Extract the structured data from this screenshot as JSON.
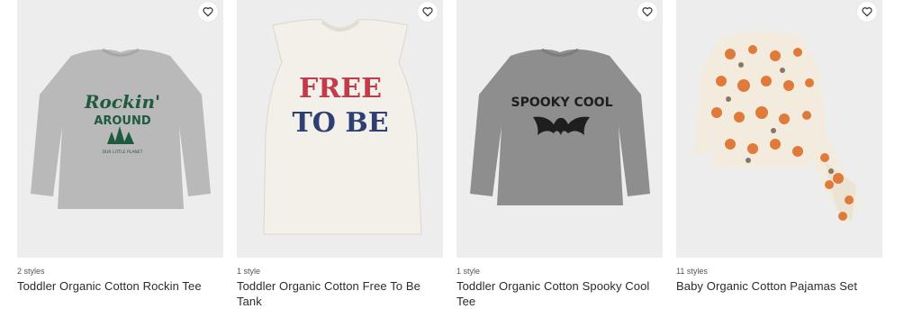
{
  "products": [
    {
      "styles_count": "2 styles",
      "title": "Toddler Organic Cotton Rockin Tee",
      "print_lines": [
        "Rockin'",
        "AROUND",
        "OUR LITTLE PLANET"
      ],
      "image_bg": "#ededed"
    },
    {
      "styles_count": "1 style",
      "title": "Toddler Organic Cotton Free To Be Tank",
      "print_lines": [
        "FREE",
        "TO BE"
      ],
      "image_bg": "#ededed"
    },
    {
      "styles_count": "1 style",
      "title": "Toddler Organic Cotton Spooky Cool Tee",
      "print_lines": [
        "SPOOKY COOL"
      ],
      "image_bg": "#ededed"
    },
    {
      "styles_count": "11 styles",
      "title": "Baby Organic Cotton Pajamas Set",
      "print_lines": [],
      "image_bg": "#ededed"
    }
  ],
  "icons": {
    "favorite": "heart-outline-icon"
  },
  "colors": {
    "accent_green": "#1f5a3f",
    "red": "#c23b4a",
    "navy": "#2f3e73",
    "pumpkin": "#e07a3a"
  }
}
